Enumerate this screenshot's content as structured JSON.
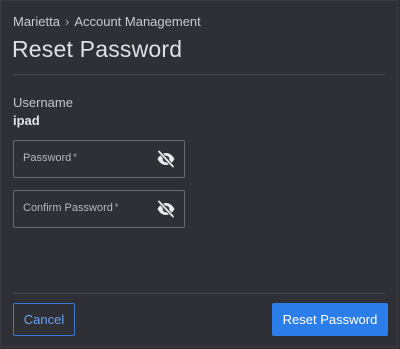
{
  "breadcrumb": {
    "parent": "Marietta",
    "separator": "›",
    "current": "Account Management"
  },
  "title": "Reset Password",
  "username": {
    "label": "Username",
    "value": "ipad"
  },
  "fields": {
    "password": {
      "placeholder": "Password",
      "required_mark": "*",
      "icon": "eye-slash-icon"
    },
    "confirm": {
      "placeholder": "Confirm Password",
      "required_mark": "*",
      "icon": "eye-slash-icon"
    }
  },
  "buttons": {
    "cancel": "Cancel",
    "reset": "Reset Password"
  },
  "colors": {
    "background": "#2f3036",
    "primary": "#2b7de9",
    "cancel_border": "#3a78d8"
  }
}
